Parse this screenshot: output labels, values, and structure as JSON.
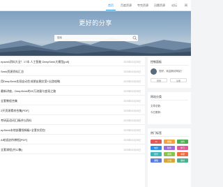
{
  "nav": {
    "items": [
      "首页",
      "百度资源",
      "夸克资源",
      "迅雷资源",
      "论坛",
      "网"
    ],
    "active_index": 0
  },
  "hero": {
    "title": "更好的分享",
    "search_placeholder": "搜索"
  },
  "list": {
    "rows": [
      {
        "title": "epseek资料大全！17本 人工智能 DeepSeek大模型[pdf]",
        "date": "2025年02月28日"
      },
      {
        "title": "Seek资源资料汇总",
        "date": "2025年02月28日"
      },
      {
        "title": "用DeepSeek实现自动生成朋友圈文案+出游攻略",
        "date": "2025年02月28日"
      },
      {
        "title": "最新讲座，DeepSeek的20万流量与变现之路",
        "date": "2025年02月28日"
      },
      {
        "title": "全套教程合集",
        "date": "2025年02月28日"
      },
      {
        "title": "2开资源素材合集[PDF]",
        "date": "2025年02月28日"
      },
      {
        "title": "考研英语词汇精讲与资料",
        "date": "2025年02月28日"
      },
      {
        "title": "epSeek本地部署保姆级+全套实用包",
        "date": "2025年02月28日"
      },
      {
        "title": "AI绘画创作教程[PDF]",
        "date": "2025年02月28日"
      },
      {
        "title": "全套课程(共12集)",
        "date": "2025年02月28日"
      }
    ]
  },
  "sidebar": {
    "control": {
      "title": "控制面板",
      "greeting": "您好，欢迎到访网站！",
      "buttons": [
        "登录",
        "注册"
      ]
    },
    "stats": {
      "title": "网站分类",
      "lines": [
        "文章总数：",
        "今日更新："
      ]
    },
    "tags": {
      "title": "热门标签",
      "items": [
        {
          "label": "AI",
          "color": "#e05a5a"
        },
        {
          "label": "教程",
          "color": "#f0a23c"
        },
        {
          "label": "资料",
          "color": "#4caf50"
        },
        {
          "label": "电影",
          "color": "#2b8fe6"
        },
        {
          "label": "软件",
          "color": "#9c6bd6"
        },
        {
          "label": "学习",
          "color": "#e05a9a"
        },
        {
          "label": "音乐",
          "color": "#3cb6b6"
        },
        {
          "label": "游戏",
          "color": "#8bc34a"
        },
        {
          "label": "考研",
          "color": "#f06a3c"
        },
        {
          "label": "课程",
          "color": "#5a7be0"
        },
        {
          "label": "小说",
          "color": "#d6a63c"
        },
        {
          "label": "素材",
          "color": "#4caf90"
        }
      ]
    }
  },
  "colors": {
    "accent": "#2b8fe6"
  }
}
